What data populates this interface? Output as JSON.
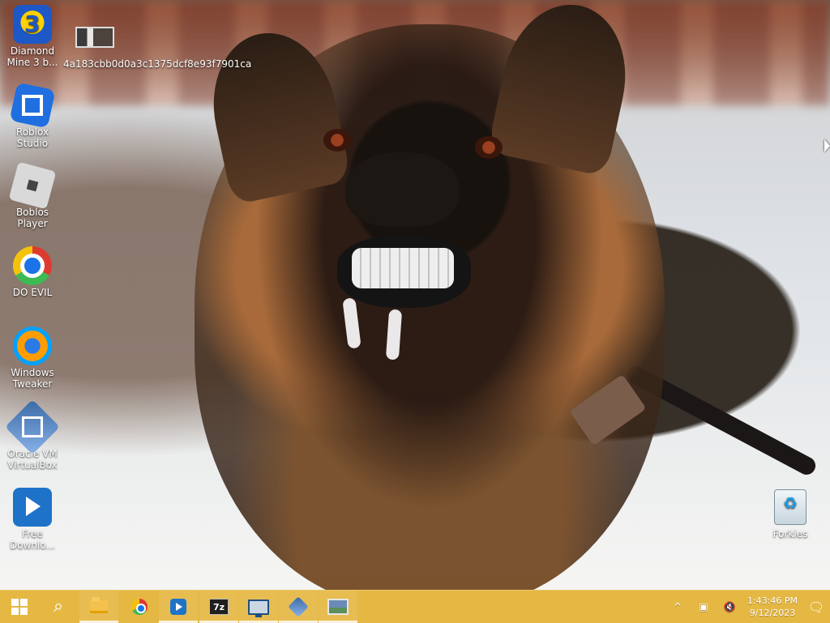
{
  "desktop": {
    "icons": [
      {
        "label": "Diamond Mine 3 b...",
        "icon": "diamond-mine-icon"
      },
      {
        "label": "4a183cbb0d0a3c1375dcf8e93f7901ca",
        "icon": "image-file-icon"
      },
      {
        "label": "Roblox Studio",
        "icon": "roblox-studio-icon"
      },
      {
        "label": "Boblos Player",
        "icon": "roblox-player-icon"
      },
      {
        "label": "DO EVIL",
        "icon": "chrome-icon"
      },
      {
        "label": "Windows Tweaker",
        "icon": "windows-tweaker-icon"
      },
      {
        "label": "Oracle VM VirtualBox",
        "icon": "virtualbox-icon"
      },
      {
        "label": "Free Downlo...",
        "icon": "free-download-manager-icon"
      },
      {
        "label": "Forkies",
        "icon": "recycle-bin-icon"
      }
    ]
  },
  "taskbar": {
    "items": [
      {
        "name": "start-button",
        "icon": "windows-logo-icon"
      },
      {
        "name": "search-button",
        "icon": "search-icon"
      },
      {
        "name": "file-explorer",
        "icon": "folder-icon"
      },
      {
        "name": "chrome",
        "icon": "chrome-icon"
      },
      {
        "name": "free-download-manager",
        "icon": "fdm-icon"
      },
      {
        "name": "7zip",
        "icon": "7z-icon",
        "text": "7z"
      },
      {
        "name": "remote-desktop",
        "icon": "monitor-icon"
      },
      {
        "name": "virtualbox",
        "icon": "virtualbox-icon"
      },
      {
        "name": "image-viewer",
        "icon": "image-viewer-icon"
      }
    ],
    "tray": {
      "chevron": "^",
      "network_icon": "network-icon",
      "volume_icon": "muted-volume-icon",
      "time": "1:43:46 PM",
      "date": "9/12/2023",
      "notifications_icon": "notification-icon"
    },
    "color": "#e5b63c"
  }
}
